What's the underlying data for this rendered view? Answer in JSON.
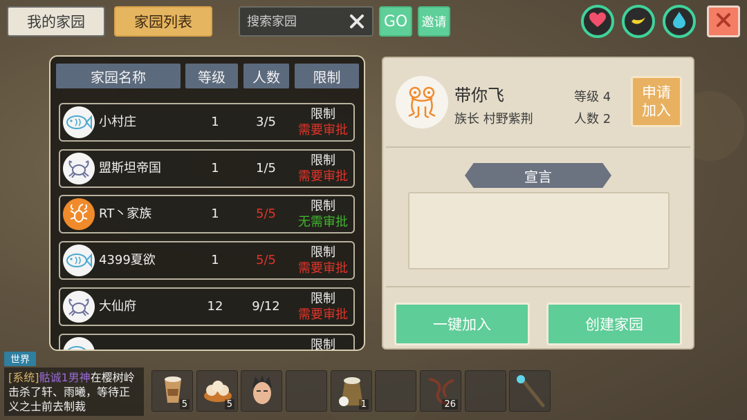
{
  "top": {
    "tab_home": "我的家园",
    "tab_list": "家园列表",
    "search_placeholder": "搜索家园",
    "go_label": "GO",
    "invite_label": "邀请"
  },
  "list": {
    "headers": {
      "name": "家园名称",
      "level": "等级",
      "count": "人数",
      "limit": "限制"
    },
    "rows": [
      {
        "icon": "fish-icon",
        "name": "小村庄",
        "level": "1",
        "count": "3/5",
        "full": false,
        "limit": "限制",
        "approval": "需要审批",
        "needs": true
      },
      {
        "icon": "crab-icon",
        "name": "盟斯坦帝国",
        "level": "1",
        "count": "1/5",
        "full": false,
        "limit": "限制",
        "approval": "需要审批",
        "needs": true
      },
      {
        "icon": "scorpion-icon",
        "name": "RT丶家族",
        "level": "1",
        "count": "5/5",
        "full": true,
        "limit": "限制",
        "approval": "无需审批",
        "needs": false
      },
      {
        "icon": "fish-icon",
        "name": "4399夏欲",
        "level": "1",
        "count": "5/5",
        "full": true,
        "limit": "限制",
        "approval": "需要审批",
        "needs": true
      },
      {
        "icon": "crab-icon",
        "name": "大仙府",
        "level": "12",
        "count": "9/12",
        "full": false,
        "limit": "限制",
        "approval": "需要审批",
        "needs": true
      },
      {
        "icon": "fish-icon",
        "name": "",
        "level": "",
        "count": "",
        "full": false,
        "limit": "限制",
        "approval": "",
        "needs": true
      }
    ]
  },
  "detail": {
    "icon": "frog-icon",
    "name": "带你飞",
    "leader": "族长  村野紫荆",
    "level": "等级 4",
    "count": "人数 2",
    "apply_line1": "申请",
    "apply_line2": "加入",
    "declaration_title": "宣言",
    "declaration_text": "",
    "quick_join": "一键加入",
    "create": "创建家园"
  },
  "chat": {
    "channel": "世界",
    "system": "[系统]",
    "player": "骷诚1男神",
    "message": "在樱树岭击杀了轩、雨曦，等待正义之士前去制裁"
  },
  "hotbar": [
    {
      "icon": "coffee-icon",
      "qty": "5"
    },
    {
      "icon": "dumpling-icon",
      "qty": "5"
    },
    {
      "icon": "character-head-icon",
      "qty": ""
    },
    {
      "icon": "empty-slot",
      "qty": ""
    },
    {
      "icon": "rice-sack-icon",
      "qty": "1"
    },
    {
      "icon": "empty-slot",
      "qty": ""
    },
    {
      "icon": "vine-icon",
      "qty": "26"
    },
    {
      "icon": "empty-slot",
      "qty": ""
    },
    {
      "icon": "staff-icon",
      "qty": ""
    }
  ],
  "colors": {
    "accent_green": "#5ecf98",
    "accent_orange": "#e6b560",
    "required_red": "#e0342a",
    "not_required_green": "#3fb62f",
    "close_red": "#f47d65"
  }
}
